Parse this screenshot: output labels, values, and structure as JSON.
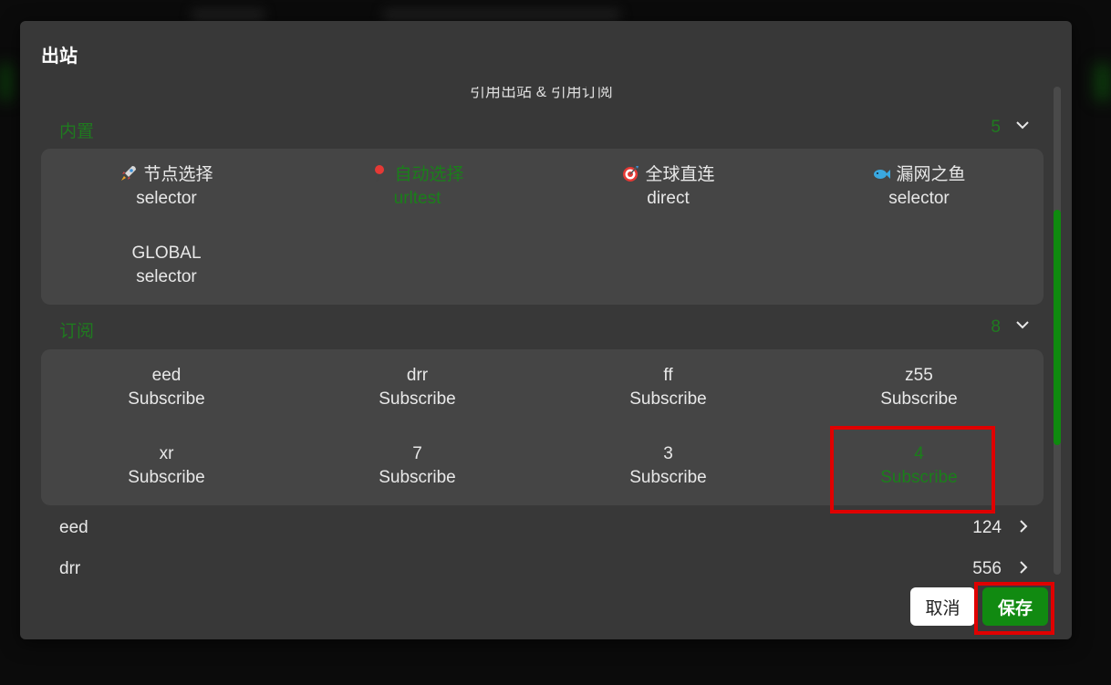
{
  "dialog": {
    "title": "出站",
    "partial_heading": "引用出站 & 引用订阅"
  },
  "builtin": {
    "label": "内置",
    "count": "5",
    "items": [
      {
        "title": "节点选择",
        "type": "selector",
        "icon": "rocket-icon",
        "selected": false
      },
      {
        "title": "自动选择",
        "type": "urltest",
        "icon": "pushpin-icon",
        "selected": true
      },
      {
        "title": "全球直连",
        "type": "direct",
        "icon": "dart-target-icon",
        "selected": false
      },
      {
        "title": "漏网之鱼",
        "type": "selector",
        "icon": "fish-icon",
        "selected": false
      },
      {
        "title": "GLOBAL",
        "type": "selector",
        "icon": "",
        "selected": false
      }
    ]
  },
  "subscriptions": {
    "label": "订阅",
    "count": "8",
    "items": [
      {
        "title": "eed",
        "type": "Subscribe",
        "selected": false
      },
      {
        "title": "drr",
        "type": "Subscribe",
        "selected": false
      },
      {
        "title": "ff",
        "type": "Subscribe",
        "selected": false
      },
      {
        "title": "z55",
        "type": "Subscribe",
        "selected": false
      },
      {
        "title": "xr",
        "type": "Subscribe",
        "selected": false
      },
      {
        "title": "7",
        "type": "Subscribe",
        "selected": false
      },
      {
        "title": "3",
        "type": "Subscribe",
        "selected": false
      },
      {
        "title": "4",
        "type": "Subscribe",
        "selected": true
      }
    ]
  },
  "groups": [
    {
      "name": "eed",
      "count": "124"
    },
    {
      "name": "drr",
      "count": "556"
    }
  ],
  "buttons": {
    "cancel": "取消",
    "save": "保存"
  },
  "colors": {
    "accent": "#118a11",
    "selected_text": "#1a7f1a",
    "highlight": "#e00000"
  }
}
